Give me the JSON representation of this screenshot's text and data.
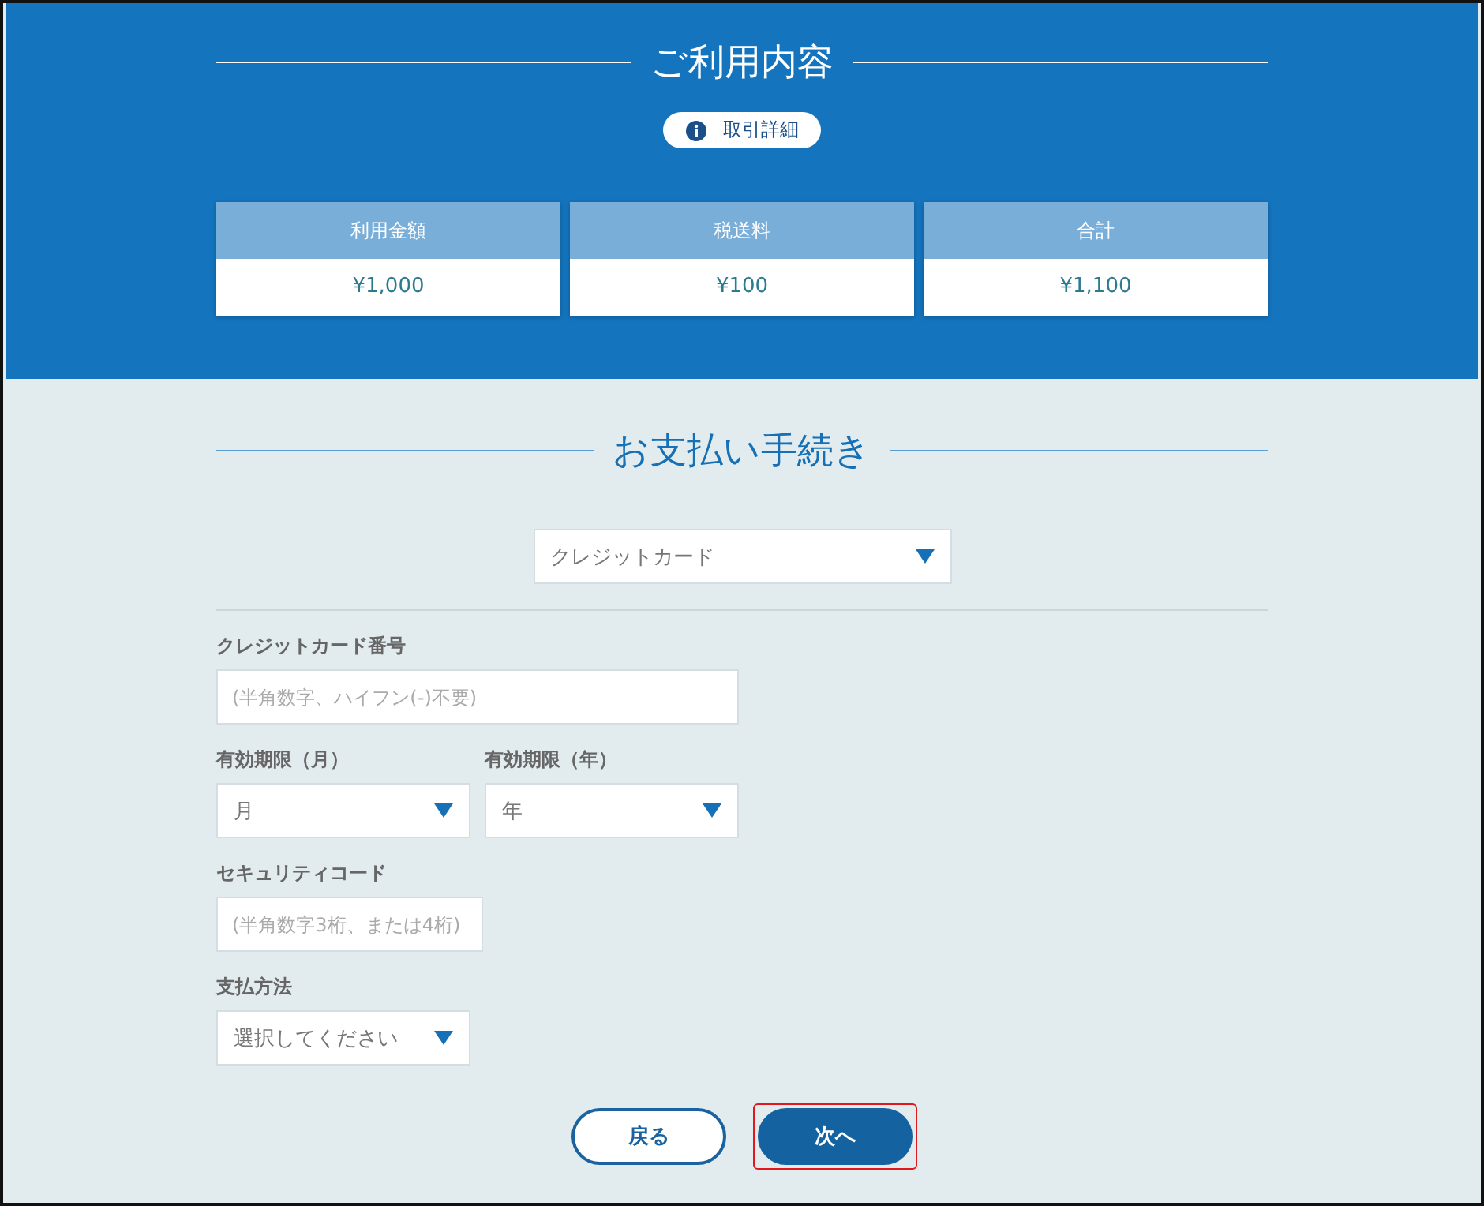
{
  "usage": {
    "title": "ご利用内容",
    "details_button": "取引詳細",
    "summary": [
      {
        "label": "利用金額",
        "value": "¥1,000"
      },
      {
        "label": "税送料",
        "value": "¥100"
      },
      {
        "label": "合計",
        "value": "¥1,100"
      }
    ]
  },
  "payment": {
    "title": "お支払い手続き",
    "method": {
      "value": "クレジットカード"
    },
    "fields": [
      {
        "kind": "number",
        "label": "クレジットカード番号",
        "placeholder": "(半角数字、ハイフン(-)不要)"
      },
      {
        "kind": "pair",
        "items": [
          {
            "label": "有効期限（月）",
            "value": "月"
          },
          {
            "label": "有効期限（年）",
            "value": "年"
          }
        ]
      },
      {
        "kind": "code",
        "label": "セキュリティコード",
        "placeholder": "(半角数字3桁、または4桁)"
      },
      {
        "kind": "select",
        "label": "支払方法",
        "value": "選択してください"
      }
    ]
  },
  "buttons": [
    {
      "label": "戻る",
      "kind": "secondary",
      "highlighted": false
    },
    {
      "label": "次へ",
      "kind": "primary",
      "highlighted": true
    }
  ]
}
